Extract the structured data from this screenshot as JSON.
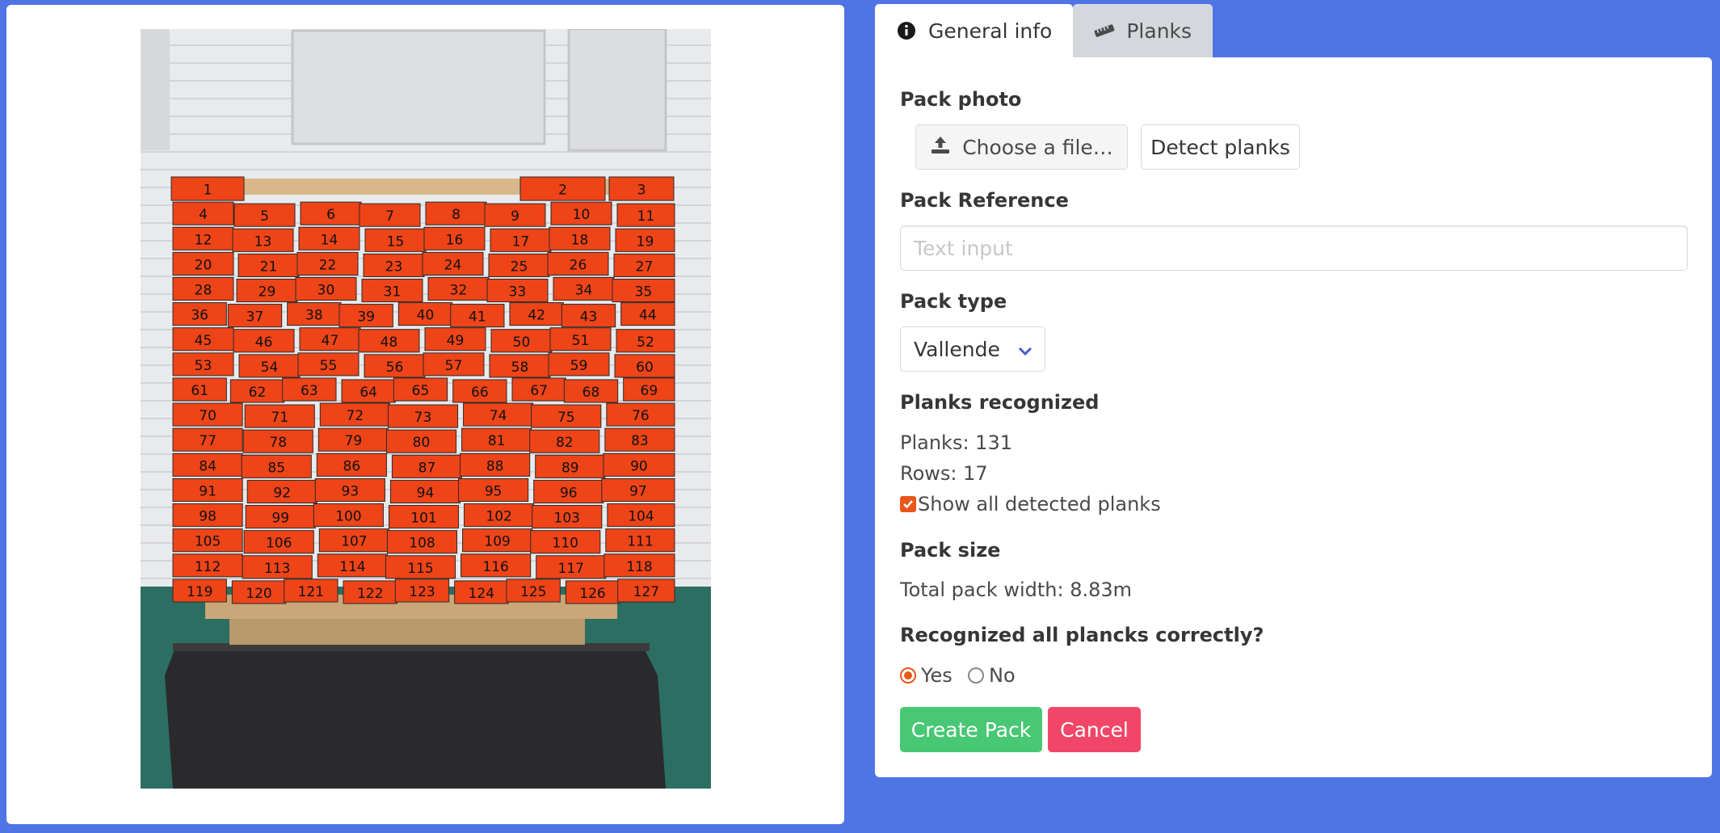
{
  "tabs": [
    {
      "label": "General info",
      "icon": "info-circle-icon",
      "active": true
    },
    {
      "label": "Planks",
      "icon": "ruler-icon",
      "active": false
    }
  ],
  "form": {
    "pack_photo_label": "Pack photo",
    "choose_file_label": "Choose a file…",
    "detect_planks_label": "Detect planks",
    "pack_reference_label": "Pack Reference",
    "pack_reference_placeholder": "Text input",
    "pack_reference_value": "",
    "pack_type_label": "Pack type",
    "pack_type_value": "Vallende",
    "planks_recognized_label": "Planks recognized",
    "planks_text": "Planks: 131",
    "rows_text": "Rows: 17",
    "show_all_label": "Show all detected planks",
    "show_all_checked": true,
    "pack_size_label": "Pack size",
    "total_width_text": "Total pack width: 8.83m",
    "recognized_question": "Recognized all plancks correctly?",
    "yes_label": "Yes",
    "no_label": "No",
    "selected_answer": "Yes",
    "create_label": "Create Pack",
    "cancel_label": "Cancel"
  },
  "photo": {
    "plank_count": 131,
    "plank_color": "#ee4418"
  },
  "colors": {
    "background": "#4f74e4",
    "accent": "#e8561a",
    "success": "#48c774",
    "danger": "#f14668"
  }
}
